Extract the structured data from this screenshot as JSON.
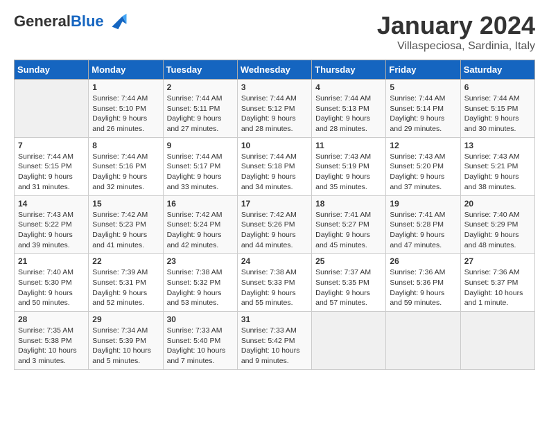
{
  "header": {
    "logo_general": "General",
    "logo_blue": "Blue",
    "month_title": "January 2024",
    "location": "Villaspeciosa, Sardinia, Italy"
  },
  "days_of_week": [
    "Sunday",
    "Monday",
    "Tuesday",
    "Wednesday",
    "Thursday",
    "Friday",
    "Saturday"
  ],
  "weeks": [
    [
      {
        "day": "",
        "sunrise": "",
        "sunset": "",
        "daylight": ""
      },
      {
        "day": "1",
        "sunrise": "Sunrise: 7:44 AM",
        "sunset": "Sunset: 5:10 PM",
        "daylight": "Daylight: 9 hours and 26 minutes."
      },
      {
        "day": "2",
        "sunrise": "Sunrise: 7:44 AM",
        "sunset": "Sunset: 5:11 PM",
        "daylight": "Daylight: 9 hours and 27 minutes."
      },
      {
        "day": "3",
        "sunrise": "Sunrise: 7:44 AM",
        "sunset": "Sunset: 5:12 PM",
        "daylight": "Daylight: 9 hours and 28 minutes."
      },
      {
        "day": "4",
        "sunrise": "Sunrise: 7:44 AM",
        "sunset": "Sunset: 5:13 PM",
        "daylight": "Daylight: 9 hours and 28 minutes."
      },
      {
        "day": "5",
        "sunrise": "Sunrise: 7:44 AM",
        "sunset": "Sunset: 5:14 PM",
        "daylight": "Daylight: 9 hours and 29 minutes."
      },
      {
        "day": "6",
        "sunrise": "Sunrise: 7:44 AM",
        "sunset": "Sunset: 5:15 PM",
        "daylight": "Daylight: 9 hours and 30 minutes."
      }
    ],
    [
      {
        "day": "7",
        "sunrise": "Sunrise: 7:44 AM",
        "sunset": "Sunset: 5:15 PM",
        "daylight": "Daylight: 9 hours and 31 minutes."
      },
      {
        "day": "8",
        "sunrise": "Sunrise: 7:44 AM",
        "sunset": "Sunset: 5:16 PM",
        "daylight": "Daylight: 9 hours and 32 minutes."
      },
      {
        "day": "9",
        "sunrise": "Sunrise: 7:44 AM",
        "sunset": "Sunset: 5:17 PM",
        "daylight": "Daylight: 9 hours and 33 minutes."
      },
      {
        "day": "10",
        "sunrise": "Sunrise: 7:44 AM",
        "sunset": "Sunset: 5:18 PM",
        "daylight": "Daylight: 9 hours and 34 minutes."
      },
      {
        "day": "11",
        "sunrise": "Sunrise: 7:43 AM",
        "sunset": "Sunset: 5:19 PM",
        "daylight": "Daylight: 9 hours and 35 minutes."
      },
      {
        "day": "12",
        "sunrise": "Sunrise: 7:43 AM",
        "sunset": "Sunset: 5:20 PM",
        "daylight": "Daylight: 9 hours and 37 minutes."
      },
      {
        "day": "13",
        "sunrise": "Sunrise: 7:43 AM",
        "sunset": "Sunset: 5:21 PM",
        "daylight": "Daylight: 9 hours and 38 minutes."
      }
    ],
    [
      {
        "day": "14",
        "sunrise": "Sunrise: 7:43 AM",
        "sunset": "Sunset: 5:22 PM",
        "daylight": "Daylight: 9 hours and 39 minutes."
      },
      {
        "day": "15",
        "sunrise": "Sunrise: 7:42 AM",
        "sunset": "Sunset: 5:23 PM",
        "daylight": "Daylight: 9 hours and 41 minutes."
      },
      {
        "day": "16",
        "sunrise": "Sunrise: 7:42 AM",
        "sunset": "Sunset: 5:24 PM",
        "daylight": "Daylight: 9 hours and 42 minutes."
      },
      {
        "day": "17",
        "sunrise": "Sunrise: 7:42 AM",
        "sunset": "Sunset: 5:26 PM",
        "daylight": "Daylight: 9 hours and 44 minutes."
      },
      {
        "day": "18",
        "sunrise": "Sunrise: 7:41 AM",
        "sunset": "Sunset: 5:27 PM",
        "daylight": "Daylight: 9 hours and 45 minutes."
      },
      {
        "day": "19",
        "sunrise": "Sunrise: 7:41 AM",
        "sunset": "Sunset: 5:28 PM",
        "daylight": "Daylight: 9 hours and 47 minutes."
      },
      {
        "day": "20",
        "sunrise": "Sunrise: 7:40 AM",
        "sunset": "Sunset: 5:29 PM",
        "daylight": "Daylight: 9 hours and 48 minutes."
      }
    ],
    [
      {
        "day": "21",
        "sunrise": "Sunrise: 7:40 AM",
        "sunset": "Sunset: 5:30 PM",
        "daylight": "Daylight: 9 hours and 50 minutes."
      },
      {
        "day": "22",
        "sunrise": "Sunrise: 7:39 AM",
        "sunset": "Sunset: 5:31 PM",
        "daylight": "Daylight: 9 hours and 52 minutes."
      },
      {
        "day": "23",
        "sunrise": "Sunrise: 7:38 AM",
        "sunset": "Sunset: 5:32 PM",
        "daylight": "Daylight: 9 hours and 53 minutes."
      },
      {
        "day": "24",
        "sunrise": "Sunrise: 7:38 AM",
        "sunset": "Sunset: 5:33 PM",
        "daylight": "Daylight: 9 hours and 55 minutes."
      },
      {
        "day": "25",
        "sunrise": "Sunrise: 7:37 AM",
        "sunset": "Sunset: 5:35 PM",
        "daylight": "Daylight: 9 hours and 57 minutes."
      },
      {
        "day": "26",
        "sunrise": "Sunrise: 7:36 AM",
        "sunset": "Sunset: 5:36 PM",
        "daylight": "Daylight: 9 hours and 59 minutes."
      },
      {
        "day": "27",
        "sunrise": "Sunrise: 7:36 AM",
        "sunset": "Sunset: 5:37 PM",
        "daylight": "Daylight: 10 hours and 1 minute."
      }
    ],
    [
      {
        "day": "28",
        "sunrise": "Sunrise: 7:35 AM",
        "sunset": "Sunset: 5:38 PM",
        "daylight": "Daylight: 10 hours and 3 minutes."
      },
      {
        "day": "29",
        "sunrise": "Sunrise: 7:34 AM",
        "sunset": "Sunset: 5:39 PM",
        "daylight": "Daylight: 10 hours and 5 minutes."
      },
      {
        "day": "30",
        "sunrise": "Sunrise: 7:33 AM",
        "sunset": "Sunset: 5:40 PM",
        "daylight": "Daylight: 10 hours and 7 minutes."
      },
      {
        "day": "31",
        "sunrise": "Sunrise: 7:33 AM",
        "sunset": "Sunset: 5:42 PM",
        "daylight": "Daylight: 10 hours and 9 minutes."
      },
      {
        "day": "",
        "sunrise": "",
        "sunset": "",
        "daylight": ""
      },
      {
        "day": "",
        "sunrise": "",
        "sunset": "",
        "daylight": ""
      },
      {
        "day": "",
        "sunrise": "",
        "sunset": "",
        "daylight": ""
      }
    ]
  ]
}
